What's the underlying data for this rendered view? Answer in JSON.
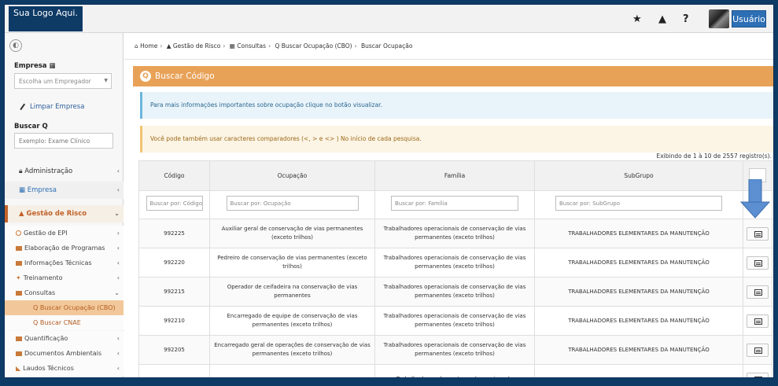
{
  "header": {
    "logo_text": "Sua Logo Aqui.",
    "icons": [
      "star-icon",
      "warning-icon",
      "help-icon"
    ],
    "user_label": "Usuário"
  },
  "sidebar": {
    "empresa_label": "Empresa",
    "empresa_placeholder": "Escolha um Empregador",
    "clear_label": "Limpar Empresa",
    "search_label": "Buscar",
    "search_placeholder": "Exemplo: Exame Clínico",
    "menu": [
      {
        "label": "Administração"
      },
      {
        "label": "Empresa"
      },
      {
        "label": "Gestão de Risco"
      }
    ],
    "submenu": [
      {
        "label": "Gestão de EPI"
      },
      {
        "label": "Elaboração de Programas"
      },
      {
        "label": "Informações Técnicas"
      },
      {
        "label": "Treinamento"
      },
      {
        "label": "Consultas"
      },
      {
        "label": "Buscar Ocupação (CBO)"
      },
      {
        "label": "Buscar CNAE"
      },
      {
        "label": "Quantificação"
      },
      {
        "label": "Documentos Ambientais"
      },
      {
        "label": "Laudos Técnicos"
      }
    ]
  },
  "breadcrumb": [
    "Home",
    "Gestão de Risco",
    "Consultas",
    "Buscar Ocupação (CBO)",
    "Buscar Ocupação"
  ],
  "panel": {
    "title": "Buscar Código",
    "info_alert": "Para mais informações importantes sobre ocupação clique no botão visualizar.",
    "warn_alert": "Você pode também usar caracteres comparadores (<, > e <> ) No início de cada pesquisa.",
    "showing": "Exibindo de 1 à 10 de 2557 registro(s)."
  },
  "table": {
    "headers": [
      "Código",
      "Ocupação",
      "Família",
      "SubGrupo"
    ],
    "filters": [
      "Buscar por: Código",
      "Buscar por: Ocupação",
      "Buscar por: Família",
      "Buscar por: SubGrupo"
    ],
    "rows": [
      {
        "codigo": "992225",
        "ocupacao": "Auxiliar geral de conservação de vias permanentes (exceto trilhos)",
        "familia": "Trabalhadores operacionais de conservação de vias permanentes (exceto trilhos)",
        "subgrupo": "TRABALHADORES ELEMENTARES DA MANUTENÇÃO"
      },
      {
        "codigo": "992220",
        "ocupacao": "Pedreiro de conservação de vias permanentes (exceto trilhos)",
        "familia": "Trabalhadores operacionais de conservação de vias permanentes (exceto trilhos)",
        "subgrupo": "TRABALHADORES ELEMENTARES DA MANUTENÇÃO"
      },
      {
        "codigo": "992215",
        "ocupacao": "Operador de ceifadeira na conservação de vias permanentes",
        "familia": "Trabalhadores operacionais de conservação de vias permanentes (exceto trilhos)",
        "subgrupo": "TRABALHADORES ELEMENTARES DA MANUTENÇÃO"
      },
      {
        "codigo": "992210",
        "ocupacao": "Encarregado de equipe de conservação de vias permanentes (exceto trilhos)",
        "familia": "Trabalhadores operacionais de conservação de vias permanentes (exceto trilhos)",
        "subgrupo": "TRABALHADORES ELEMENTARES DA MANUTENÇÃO"
      },
      {
        "codigo": "992205",
        "ocupacao": "Encarregado geral de operações de conservação de vias permanentes (exceto trilhos)",
        "familia": "Trabalhadores operacionais de conservação de vias permanentes (exceto trilhos)",
        "subgrupo": "TRABALHADORES ELEMENTARES DA MANUTENÇÃO"
      },
      {
        "codigo": "",
        "ocupacao": "",
        "familia": "Trabalhadores elementares de serviços de",
        "subgrupo": ""
      }
    ]
  },
  "colors": {
    "brand": "#0e3a66",
    "accent": "#e8a258",
    "user_button": "#2d6fb5",
    "arrow": "#5b8fd1"
  }
}
